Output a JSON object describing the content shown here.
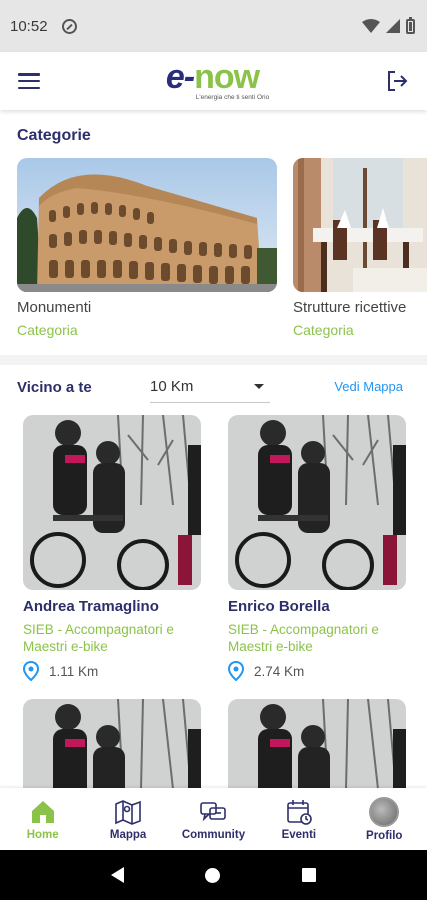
{
  "status": {
    "time": "10:52"
  },
  "header": {
    "logo_e": "e-",
    "logo_now": "now",
    "tagline": "L'energia che ti senti Orio"
  },
  "categories": {
    "title": "Categorie",
    "items": [
      {
        "name": "Monumenti",
        "sub": "Categoria"
      },
      {
        "name": "Strutture ricettive",
        "sub": "Categoria"
      }
    ]
  },
  "nearby": {
    "label": "Vicino a te",
    "distance": "10 Km",
    "map_link": "Vedi Mappa",
    "items": [
      {
        "name": "Andrea Tramaglino",
        "category": "SIEB - Accompagnatori e Maestri e-bike",
        "distance": "1.11 Km"
      },
      {
        "name": "Enrico Borella",
        "category": "SIEB - Accompagnatori e Maestri e-bike",
        "distance": "2.74 Km"
      },
      {
        "name": "",
        "category": "",
        "distance": ""
      },
      {
        "name": "",
        "category": "",
        "distance": ""
      }
    ]
  },
  "nav": {
    "items": [
      {
        "label": "Home",
        "icon": "home-icon",
        "active": true
      },
      {
        "label": "Mappa",
        "icon": "map-icon"
      },
      {
        "label": "Community",
        "icon": "community-icon"
      },
      {
        "label": "Eventi",
        "icon": "calendar-icon"
      },
      {
        "label": "Profilo",
        "icon": "avatar"
      }
    ]
  },
  "colors": {
    "brand_blue": "#2d2f6b",
    "brand_green": "#8bc34a",
    "link": "#2196f3"
  }
}
